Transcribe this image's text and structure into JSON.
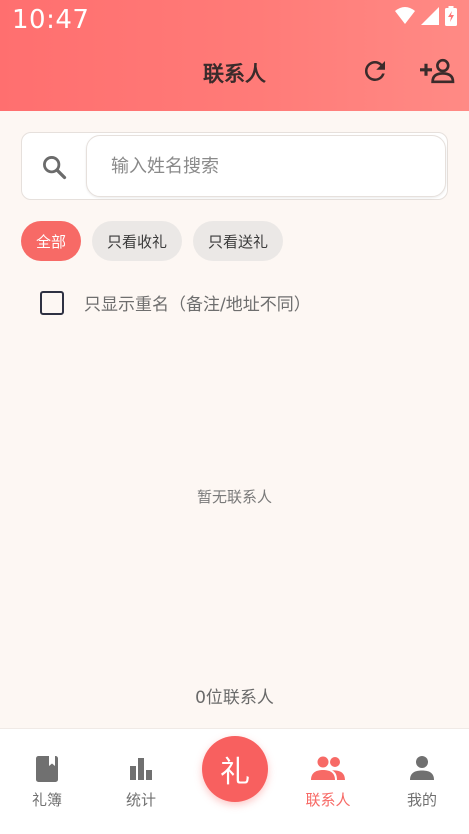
{
  "status_bar": {
    "time": "10:47"
  },
  "header": {
    "title": "联系人"
  },
  "search": {
    "placeholder": "输入姓名搜索",
    "value": ""
  },
  "filters": [
    {
      "label": "全部",
      "active": true
    },
    {
      "label": "只看收礼",
      "active": false
    },
    {
      "label": "只看送礼",
      "active": false
    }
  ],
  "duplicate_filter": {
    "label": "只显示重名（备注/地址不同）",
    "checked": false
  },
  "empty_state": {
    "message": "暂无联系人"
  },
  "contact_count": {
    "text": "0位联系人"
  },
  "bottom_nav": {
    "items": [
      {
        "label": "礼簿",
        "icon": "book-icon",
        "active": false
      },
      {
        "label": "统计",
        "icon": "bar-chart-icon",
        "active": false
      },
      {
        "label": "联系人",
        "icon": "people-icon",
        "active": true
      },
      {
        "label": "我的",
        "icon": "person-icon",
        "active": false
      }
    ],
    "center_button": {
      "label": "礼"
    }
  },
  "colors": {
    "accent": "#f76a66",
    "header_start": "#ff6f6f",
    "header_end": "#ff8a85",
    "background": "#fdf7f3"
  }
}
